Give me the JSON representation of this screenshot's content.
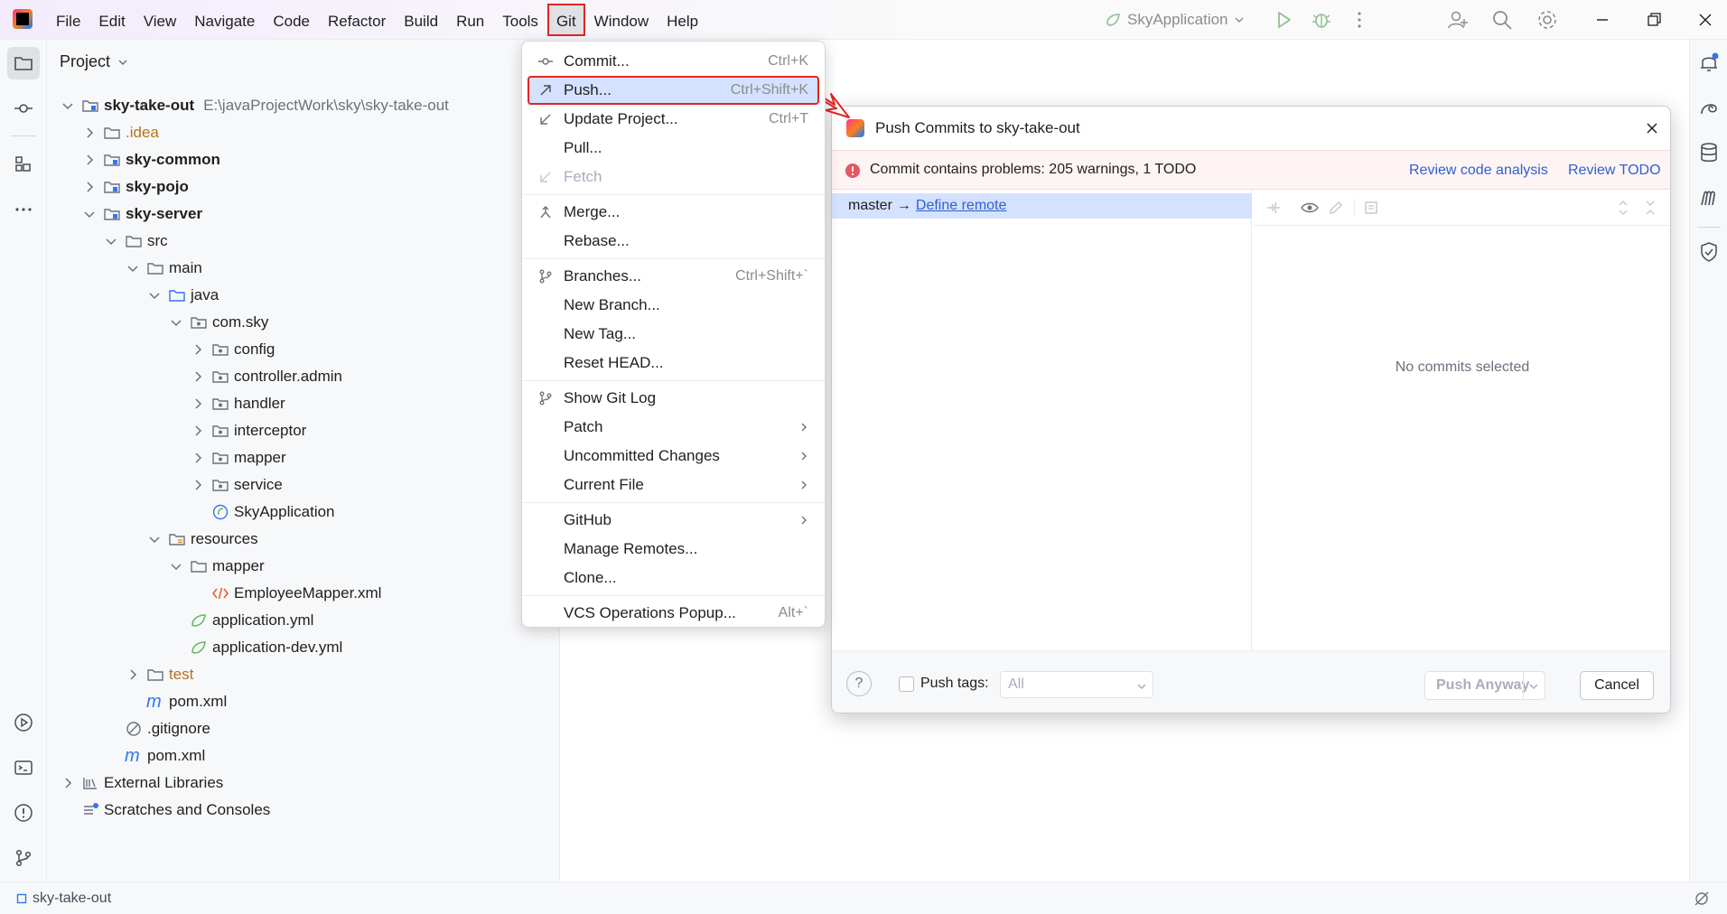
{
  "menubar": {
    "items": [
      "File",
      "Edit",
      "View",
      "Navigate",
      "Code",
      "Refactor",
      "Build",
      "Run",
      "Tools",
      "Git",
      "Window",
      "Help"
    ],
    "active": "Git"
  },
  "run_config": {
    "name": "SkyApplication"
  },
  "project_panel": {
    "header": "Project",
    "tree": [
      {
        "label": "sky-take-out",
        "path": "E:\\javaProjectWork\\sky\\sky-take-out",
        "bold": true
      },
      {
        "label": ".idea",
        "style": "orange"
      },
      {
        "label": "sky-common",
        "bold": true
      },
      {
        "label": "sky-pojo",
        "bold": true
      },
      {
        "label": "sky-server",
        "bold": true
      },
      {
        "label": "src"
      },
      {
        "label": "main"
      },
      {
        "label": "java"
      },
      {
        "label": "com.sky"
      },
      {
        "label": "config"
      },
      {
        "label": "controller.admin"
      },
      {
        "label": "handler"
      },
      {
        "label": "interceptor"
      },
      {
        "label": "mapper"
      },
      {
        "label": "service"
      },
      {
        "label": "SkyApplication"
      },
      {
        "label": "resources"
      },
      {
        "label": "mapper"
      },
      {
        "label": "EmployeeMapper.xml"
      },
      {
        "label": "application.yml"
      },
      {
        "label": "application-dev.yml"
      },
      {
        "label": "test",
        "style": "orange"
      },
      {
        "label": "pom.xml"
      },
      {
        "label": ".gitignore"
      },
      {
        "label": "pom.xml"
      },
      {
        "label": "External Libraries"
      },
      {
        "label": "Scratches and Consoles"
      }
    ]
  },
  "git_menu": {
    "items": [
      {
        "label": "Commit...",
        "shortcut": "Ctrl+K",
        "icon": "commit-icon"
      },
      {
        "label": "Push...",
        "shortcut": "Ctrl+Shift+K",
        "icon": "push-arrow-icon",
        "highlighted": true
      },
      {
        "label": "Update Project...",
        "shortcut": "Ctrl+T",
        "icon": "update-arrow-icon"
      },
      {
        "label": "Pull..."
      },
      {
        "label": "Fetch",
        "disabled": true,
        "icon": "fetch-arrow-icon"
      },
      {
        "label": "Merge...",
        "icon": "merge-icon"
      },
      {
        "label": "Rebase..."
      },
      {
        "label": "Branches...",
        "shortcut": "Ctrl+Shift+`",
        "icon": "branch-icon"
      },
      {
        "label": "New Branch..."
      },
      {
        "label": "New Tag..."
      },
      {
        "label": "Reset HEAD..."
      },
      {
        "label": "Show Git Log",
        "icon": "git-log-icon"
      },
      {
        "label": "Patch",
        "submenu": true
      },
      {
        "label": "Uncommitted Changes",
        "submenu": true
      },
      {
        "label": "Current File",
        "submenu": true
      },
      {
        "label": "GitHub",
        "submenu": true
      },
      {
        "label": "Manage Remotes..."
      },
      {
        "label": "Clone..."
      },
      {
        "label": "VCS Operations Popup...",
        "shortcut": "Alt+`"
      }
    ]
  },
  "push_dialog": {
    "title": "Push Commits to sky-take-out",
    "warning": "Commit contains problems: 205 warnings, 1 TODO",
    "review_code_link": "Review code analysis",
    "review_todo_link": "Review TODO",
    "branch": "master",
    "arrow": "→",
    "define_remote": "Define remote",
    "empty_message": "No commits selected",
    "push_tags_label": "Push tags:",
    "push_tags_value": "All",
    "push_anyway": "Push Anyway",
    "cancel": "Cancel"
  },
  "statusbar": {
    "project": "sky-take-out"
  },
  "colors": {
    "accent": "#3574f0",
    "highlight": "#d4e2ff",
    "error": "#e12525",
    "link": "#2f5fcf"
  }
}
